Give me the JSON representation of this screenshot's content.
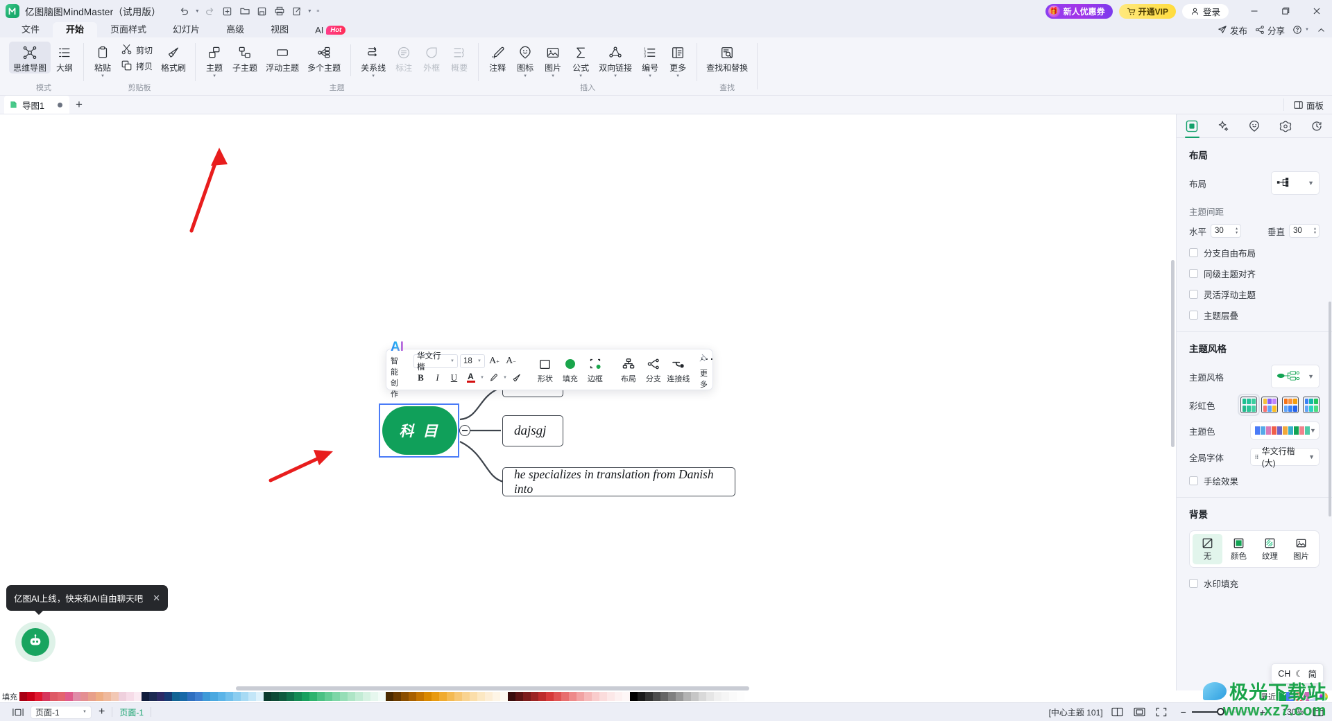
{
  "window": {
    "title": "亿图脑图MindMaster（试用版）",
    "quick_access": [
      "undo-icon",
      "redo-icon",
      "new-icon",
      "open-icon",
      "save-icon",
      "print-icon",
      "export-icon"
    ],
    "promo_label": "新人优惠券",
    "vip_label": "开通VIP",
    "login_label": "登录",
    "minimize": "—",
    "maximize": "❐",
    "close": "✕"
  },
  "ribbon": {
    "tabs": [
      {
        "label": "文件",
        "active": false
      },
      {
        "label": "开始",
        "active": true
      },
      {
        "label": "页面样式",
        "active": false
      },
      {
        "label": "幻灯片",
        "active": false
      },
      {
        "label": "高级",
        "active": false
      },
      {
        "label": "视图",
        "active": false
      },
      {
        "label": "AI",
        "active": false,
        "badge": "Hot"
      }
    ],
    "actions": [
      {
        "label": "发布",
        "icon": "send-icon"
      },
      {
        "label": "分享",
        "icon": "share-icon"
      },
      {
        "label": "",
        "icon": "help-icon"
      },
      {
        "label": "",
        "icon": "chevron-up-icon"
      }
    ],
    "groups": [
      {
        "label": "模式",
        "items": [
          {
            "label": "思维导图",
            "icon": "mindmap-icon",
            "active": true,
            "dropdown": false,
            "disabled": false
          },
          {
            "label": "大纲",
            "icon": "outline-icon",
            "active": false,
            "dropdown": false,
            "disabled": false
          }
        ]
      },
      {
        "label": "剪贴板",
        "items": [
          {
            "label": "粘贴",
            "icon": "paste-icon",
            "dropdown": true,
            "disabled": false
          },
          {
            "label": "剪切",
            "icon": "cut-icon",
            "dropdown": false,
            "disabled": false
          },
          {
            "label": "拷贝",
            "icon": "copy-icon",
            "dropdown": false,
            "disabled": false
          },
          {
            "label": "格式刷",
            "icon": "format-painter-icon",
            "dropdown": false,
            "disabled": false
          }
        ]
      },
      {
        "label": "主题",
        "items": [
          {
            "label": "主题",
            "icon": "topic-icon",
            "dropdown": true,
            "disabled": false
          },
          {
            "label": "子主题",
            "icon": "subtopic-icon",
            "dropdown": false,
            "disabled": false
          },
          {
            "label": "浮动主题",
            "icon": "floating-topic-icon",
            "dropdown": false,
            "disabled": false
          },
          {
            "label": "多个主题",
            "icon": "multi-topic-icon",
            "dropdown": false,
            "disabled": false
          },
          {
            "label": "关系线",
            "icon": "relationship-line-icon",
            "dropdown": true,
            "disabled": false
          },
          {
            "label": "标注",
            "icon": "callout-icon",
            "dropdown": false,
            "disabled": true
          },
          {
            "label": "外框",
            "icon": "boundary-icon",
            "dropdown": false,
            "disabled": true
          },
          {
            "label": "概要",
            "icon": "summary-icon",
            "dropdown": false,
            "disabled": true
          }
        ]
      },
      {
        "label": "插入",
        "items": [
          {
            "label": "注释",
            "icon": "comment-icon",
            "dropdown": false,
            "disabled": false
          },
          {
            "label": "图标",
            "icon": "sticker-icon",
            "dropdown": true,
            "disabled": false
          },
          {
            "label": "图片",
            "icon": "image-icon",
            "dropdown": true,
            "disabled": false
          },
          {
            "label": "公式",
            "icon": "formula-icon",
            "dropdown": true,
            "disabled": false
          },
          {
            "label": "双向链接",
            "icon": "bidirectional-link-icon",
            "dropdown": true,
            "disabled": false
          },
          {
            "label": "编号",
            "icon": "numbering-icon",
            "dropdown": true,
            "disabled": false
          },
          {
            "label": "更多",
            "icon": "more-insert-icon",
            "dropdown": true,
            "disabled": false
          }
        ]
      },
      {
        "label": "查找",
        "items": [
          {
            "label": "查找和替换",
            "icon": "find-replace-icon",
            "dropdown": false,
            "disabled": false
          }
        ]
      }
    ]
  },
  "doctabs": {
    "tabs": [
      {
        "label": "导图1",
        "modified": true
      }
    ],
    "add_label": "+",
    "panel_toggle_label": "面板"
  },
  "format_toolbar": {
    "ai_label": "AI",
    "ai_sub": "智能创作",
    "font_family": "华文行楷",
    "font_size": "18",
    "increase_label": "A",
    "decrease_label": "A",
    "bold": "B",
    "italic": "I",
    "underline": "U",
    "font_color": "A",
    "highlight_icon": "highlighter-icon",
    "clear_format_icon": "clear-format-icon",
    "cells": [
      {
        "label": "形状",
        "icon": "shape-icon"
      },
      {
        "label": "填充",
        "icon": "fill-icon"
      },
      {
        "label": "边框",
        "icon": "border-icon"
      },
      {
        "label": "布局",
        "icon": "layout-icon"
      },
      {
        "label": "分支",
        "icon": "branch-icon"
      },
      {
        "label": "连接线",
        "icon": "connector-icon"
      },
      {
        "label": "更多",
        "icon": "more-dots-icon"
      }
    ],
    "fill_color": "#19a54b",
    "font_color_swatch": "#d40f0f"
  },
  "mindmap": {
    "root_text": "科 目",
    "root_fill": "#10a05a",
    "selection_color": "#4a7bf7",
    "nodes": [
      {
        "text": "",
        "name": "topic-node-top"
      },
      {
        "text": "dajsgj",
        "name": "topic-node-middle"
      },
      {
        "text": "he specializes in translation from Danish into",
        "name": "topic-node-bottom"
      }
    ],
    "collapse_toggle": "−"
  },
  "sidebar": {
    "tabs": [
      {
        "icon": "layout-panel-icon",
        "active": true
      },
      {
        "icon": "ai-sparkle-icon",
        "active": false
      },
      {
        "icon": "emoji-icon",
        "active": false
      },
      {
        "icon": "flower-icon",
        "active": false
      },
      {
        "icon": "history-icon",
        "active": false
      }
    ],
    "layout": {
      "heading": "布局",
      "layout_label": "布局",
      "spacing_heading": "主题间距",
      "horizontal_label": "水平",
      "horizontal_value": "30",
      "vertical_label": "垂直",
      "vertical_value": "30",
      "checkboxes": [
        {
          "label": "分支自由布局",
          "checked": false
        },
        {
          "label": "同级主题对齐",
          "checked": false
        },
        {
          "label": "灵活浮动主题",
          "checked": false
        },
        {
          "label": "主题层叠",
          "checked": false
        }
      ]
    },
    "theme": {
      "heading": "主题风格",
      "style_label": "主题风格",
      "rainbow_label": "彩虹色",
      "theme_color_label": "主题色",
      "theme_colors": [
        "#4a7bf7",
        "#56a8e8",
        "#d97ab8",
        "#ef5f4a",
        "#6c63c8",
        "#f2a93b",
        "#38b0c9",
        "#12a353",
        "#f1828d",
        "#4fcba6"
      ],
      "global_font_label": "全局字体",
      "global_font_value": "华文行楷 (大)",
      "hand_drawn_label": "手绘效果",
      "hand_drawn_checked": false
    },
    "background": {
      "heading": "背景",
      "options": [
        {
          "label": "无",
          "icon": "none-icon",
          "active": true
        },
        {
          "label": "颜色",
          "icon": "color-icon",
          "active": false
        },
        {
          "label": "纹理",
          "icon": "texture-icon",
          "active": false
        },
        {
          "label": "图片",
          "icon": "picture-icon",
          "active": false
        }
      ],
      "watermark_label": "水印填充",
      "watermark_checked": false
    },
    "ime": {
      "lang": "CH",
      "mode_icon": "moon-icon",
      "shape": "简"
    }
  },
  "colorstrip": {
    "label": "填充",
    "recent_label": "最近",
    "recent_colors": [
      "#12a353",
      "#4a7bf7",
      "#ef5f4a",
      "#c96bb8",
      "#c9d5f5"
    ],
    "wheel_icon": "color-wheel-icon"
  },
  "statusbar": {
    "fit_icon": "fit-page-icon",
    "page_value": "页面-1",
    "add_page": "+",
    "active_page": "页面-1",
    "center_topic_info": "[中心主题 101]",
    "view_icons": [
      "two-page-icon",
      "fit-window-icon",
      "fullscreen-icon"
    ],
    "zoom_out": "−",
    "zoom_in": "+",
    "zoom_level": "130%"
  },
  "toast": {
    "message": "亿图AI上线，快来和AI自由聊天吧",
    "close": "✕",
    "fab_icon": "ai-robot-icon"
  },
  "watermark": {
    "line1": "极光下载站",
    "line2": "www.xz7.com"
  }
}
